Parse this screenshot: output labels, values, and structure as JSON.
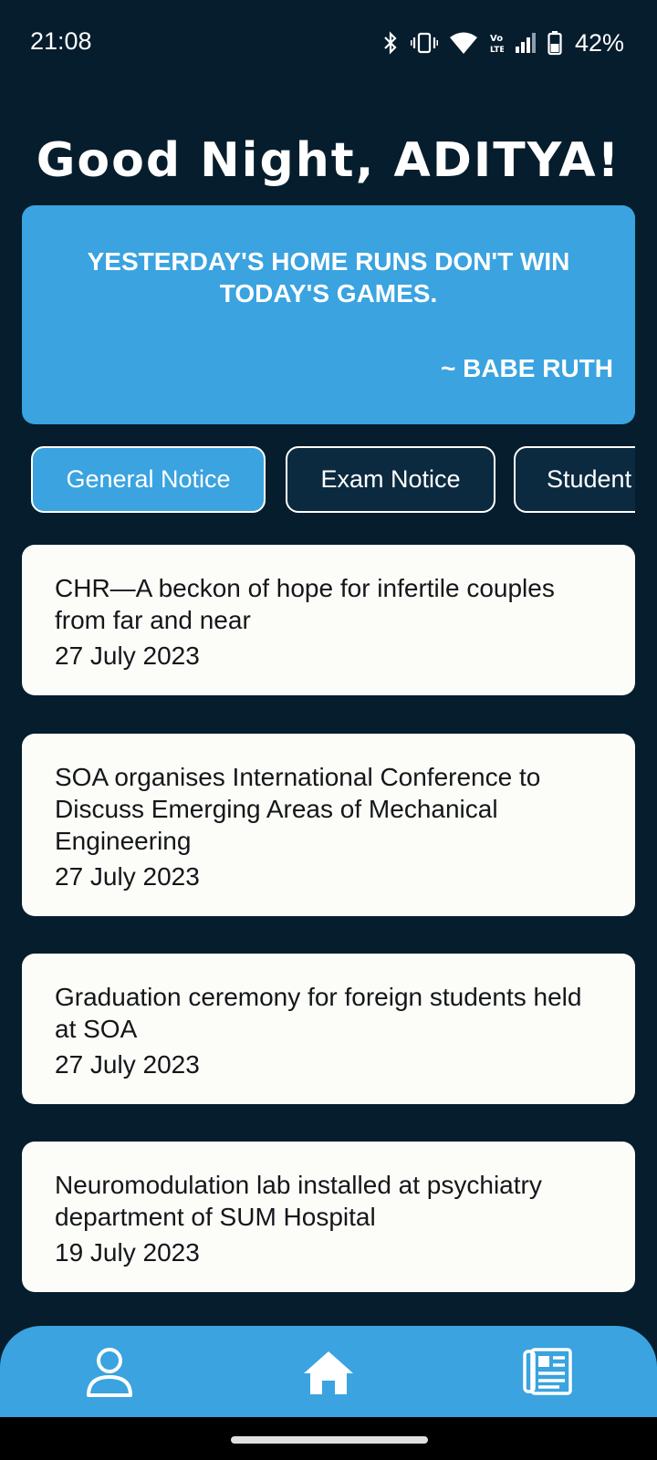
{
  "status_bar": {
    "time": "21:08",
    "battery": "42%",
    "icons": [
      "bluetooth-icon",
      "vibrate-icon",
      "wifi-icon",
      "volte-icon",
      "signal-icon",
      "battery-icon"
    ]
  },
  "greeting": "Good Night, ADITYA!",
  "quote": {
    "text": "YESTERDAY'S HOME RUNS DON'T WIN TODAY'S GAMES.",
    "author": "~ BABE RUTH"
  },
  "tabs": [
    {
      "label": "General Notice",
      "active": true
    },
    {
      "label": "Exam Notice",
      "active": false
    },
    {
      "label": "Student",
      "active": false
    }
  ],
  "notices": [
    {
      "title": "CHR—A beckon of hope for infertile couples from far and near",
      "date": "27 July 2023"
    },
    {
      "title": "SOA organises International Conference to Discuss Emerging Areas of Mechanical Engineering",
      "date": "27 July 2023"
    },
    {
      "title": "Graduation ceremony for foreign students held at SOA",
      "date": "27 July 2023"
    },
    {
      "title": "Neuromodulation lab installed at psychiatry department of SUM Hospital",
      "date": "19 July 2023"
    }
  ],
  "bottom_nav": [
    "profile-icon",
    "home-icon",
    "newspaper-icon"
  ],
  "colors": {
    "background": "#061d2d",
    "accent": "#3aa3e0",
    "card": "#fcfcf8",
    "tab_inactive": "#0b2a40"
  }
}
